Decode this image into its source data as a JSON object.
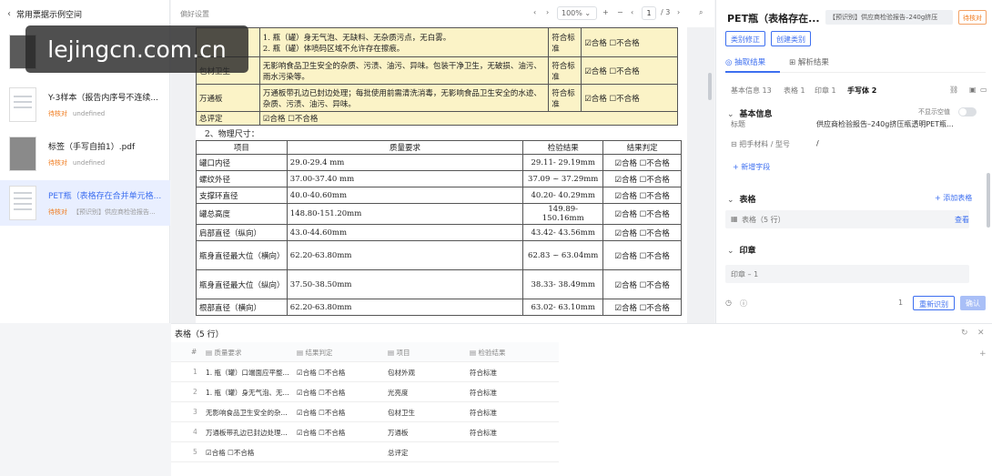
{
  "sidebar": {
    "back_label": "常用票据示例空间",
    "files": [
      {
        "name": "",
        "status": "",
        "meta": ""
      },
      {
        "name": "Y-3样本（报告内序号不连续...",
        "status": "待核对",
        "meta": "undefined"
      },
      {
        "name": "标签（手写自拍1）.pdf",
        "status": "待核对",
        "meta": "undefined"
      },
      {
        "name": "PET瓶（表格存在合并单元格...",
        "status": "待核对",
        "meta": "【预识别】供应商检验报告..."
      }
    ]
  },
  "watermark": "lejingcn.com.cn",
  "toolbar": {
    "label": "偏好设置",
    "nav_prev": "‹",
    "nav_next": "›",
    "zoom": "100%",
    "zoom_minus": "−",
    "zoom_plus": "+",
    "page_current": "1",
    "page_total": "/ 3"
  },
  "doc": {
    "table1": [
      {
        "item": "",
        "req": "1. 瓶（罐）身无气泡、无缺料、无杂质污点，无白雾。\n2. 瓶（罐）体喷码区域不允许存在擦痕。",
        "result": "符合标准",
        "judge": "☑合格 ☐不合格"
      },
      {
        "item": "包材卫生",
        "req": "无影响食品卫生安全的杂质、污渍、油污、异味。包装干净卫生，无破损、油污、雨水污染等。",
        "result": "符合标准",
        "judge": "☑合格 ☐不合格"
      },
      {
        "item": "万通板",
        "req": "万通板带孔边已封边处理；每批使用前需清洗消毒，无影响食品卫生安全的水迹、杂质、污渍、油污、异味。",
        "result": "符合标准",
        "judge": "☑合格 ☐不合格"
      },
      {
        "item": "总评定",
        "req": "☑合格 ☐不合格",
        "result": "",
        "judge": ""
      }
    ],
    "section2": "2、物理尺寸：",
    "table2_header": [
      "项目",
      "质量要求",
      "检验结果",
      "结果判定"
    ],
    "table2": [
      {
        "item": "罐口内径",
        "req": "29.0-29.4 mm",
        "result": "29.11- 29.19mm",
        "judge": "☑合格 ☐不合格"
      },
      {
        "item": "螺纹外径",
        "req": "37.00-37.40 mm",
        "result": "37.09 ~ 37.29mm",
        "judge": "☑合格 ☐不合格"
      },
      {
        "item": "支撑环直径",
        "req": "40.0-40.60mm",
        "result": "40.20- 40.29mm",
        "judge": "☑合格 ☐不合格"
      },
      {
        "item": "罐总高度",
        "req": "148.80-151.20mm",
        "result": "149.89- 150.16mm",
        "judge": "☑合格 ☐不合格"
      },
      {
        "item": "肩部直径（纵向）",
        "req": "43.0-44.60mm",
        "result": "43.42- 43.56mm",
        "judge": "☑合格 ☐不合格"
      },
      {
        "item": "瓶身直径最大位（横向）",
        "req": "62.20-63.80mm",
        "result": "62.83 ~ 63.04mm",
        "judge": "☑合格 ☐不合格"
      },
      {
        "item": "瓶身直径最大位（纵向）",
        "req": "37.50-38.50mm",
        "result": "38.33- 38.49mm",
        "judge": "☑合格 ☐不合格"
      },
      {
        "item": "根部直径（横向）",
        "req": "62.20-63.80mm",
        "result": "63.02- 63.10mm",
        "judge": "☑合格 ☐不合格"
      }
    ]
  },
  "right": {
    "title": "PET瓶（表格存在...",
    "tag": "【预识别】供应商检验报告–240g挤压",
    "badge": "待核对",
    "btn_correct": "类别修正",
    "btn_create": "创建类别",
    "tab_extract": "抽取结果",
    "tab_parse": "解析结果",
    "subtabs": [
      "基本信息 13",
      "表格 1",
      "印章 1",
      "手写体 2"
    ],
    "basic_head": "基本信息",
    "hide_empty": "不显示空值",
    "field1_label": "标题",
    "field1_value": "供应商检验报告–240g挤压瓶透明PET瓶...",
    "field2_label": "把手材料 / 型号",
    "field2_value": "/",
    "add_field": "+ 新增字段",
    "table_head": "表格",
    "add_table": "+ 添加表格",
    "table_row": "表格（5 行）",
    "view": "查看",
    "seal_head": "印章",
    "seal_row": "印章 – 1",
    "page_hint": "1",
    "btn_rerun": "重新识别",
    "btn_confirm": "确认"
  },
  "bottom": {
    "title": "表格（5 行）",
    "columns": [
      "#",
      "质量要求",
      "结果判定",
      "项目",
      "检验结果"
    ],
    "rows": [
      [
        "1",
        "1. 瓶（罐）口端面应平整...",
        "☑合格 ☐不合格",
        "包材外观",
        "符合标准"
      ],
      [
        "2",
        "1. 瓶（罐）身无气泡、无...",
        "☑合格 ☐不合格",
        "光亮度",
        "符合标准"
      ],
      [
        "3",
        "无影响食品卫生安全的杂...",
        "☑合格 ☐不合格",
        "包材卫生",
        "符合标准"
      ],
      [
        "4",
        "万通板带孔边已封边处理...",
        "☑合格 ☐不合格",
        "万通板",
        "符合标准"
      ],
      [
        "5",
        "☑合格 ☐不合格",
        "",
        "总评定",
        ""
      ]
    ]
  }
}
